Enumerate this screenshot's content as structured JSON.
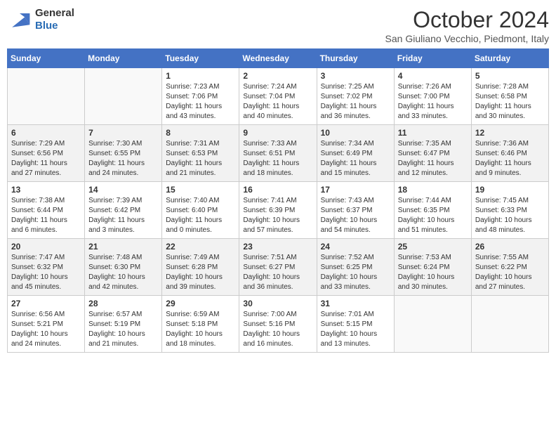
{
  "header": {
    "logo_general": "General",
    "logo_blue": "Blue",
    "month_title": "October 2024",
    "location": "San Giuliano Vecchio, Piedmont, Italy"
  },
  "days_of_week": [
    "Sunday",
    "Monday",
    "Tuesday",
    "Wednesday",
    "Thursday",
    "Friday",
    "Saturday"
  ],
  "weeks": [
    [
      {
        "day": "",
        "sunrise": "",
        "sunset": "",
        "daylight": ""
      },
      {
        "day": "",
        "sunrise": "",
        "sunset": "",
        "daylight": ""
      },
      {
        "day": "1",
        "sunrise": "Sunrise: 7:23 AM",
        "sunset": "Sunset: 7:06 PM",
        "daylight": "Daylight: 11 hours and 43 minutes."
      },
      {
        "day": "2",
        "sunrise": "Sunrise: 7:24 AM",
        "sunset": "Sunset: 7:04 PM",
        "daylight": "Daylight: 11 hours and 40 minutes."
      },
      {
        "day": "3",
        "sunrise": "Sunrise: 7:25 AM",
        "sunset": "Sunset: 7:02 PM",
        "daylight": "Daylight: 11 hours and 36 minutes."
      },
      {
        "day": "4",
        "sunrise": "Sunrise: 7:26 AM",
        "sunset": "Sunset: 7:00 PM",
        "daylight": "Daylight: 11 hours and 33 minutes."
      },
      {
        "day": "5",
        "sunrise": "Sunrise: 7:28 AM",
        "sunset": "Sunset: 6:58 PM",
        "daylight": "Daylight: 11 hours and 30 minutes."
      }
    ],
    [
      {
        "day": "6",
        "sunrise": "Sunrise: 7:29 AM",
        "sunset": "Sunset: 6:56 PM",
        "daylight": "Daylight: 11 hours and 27 minutes."
      },
      {
        "day": "7",
        "sunrise": "Sunrise: 7:30 AM",
        "sunset": "Sunset: 6:55 PM",
        "daylight": "Daylight: 11 hours and 24 minutes."
      },
      {
        "day": "8",
        "sunrise": "Sunrise: 7:31 AM",
        "sunset": "Sunset: 6:53 PM",
        "daylight": "Daylight: 11 hours and 21 minutes."
      },
      {
        "day": "9",
        "sunrise": "Sunrise: 7:33 AM",
        "sunset": "Sunset: 6:51 PM",
        "daylight": "Daylight: 11 hours and 18 minutes."
      },
      {
        "day": "10",
        "sunrise": "Sunrise: 7:34 AM",
        "sunset": "Sunset: 6:49 PM",
        "daylight": "Daylight: 11 hours and 15 minutes."
      },
      {
        "day": "11",
        "sunrise": "Sunrise: 7:35 AM",
        "sunset": "Sunset: 6:47 PM",
        "daylight": "Daylight: 11 hours and 12 minutes."
      },
      {
        "day": "12",
        "sunrise": "Sunrise: 7:36 AM",
        "sunset": "Sunset: 6:46 PM",
        "daylight": "Daylight: 11 hours and 9 minutes."
      }
    ],
    [
      {
        "day": "13",
        "sunrise": "Sunrise: 7:38 AM",
        "sunset": "Sunset: 6:44 PM",
        "daylight": "Daylight: 11 hours and 6 minutes."
      },
      {
        "day": "14",
        "sunrise": "Sunrise: 7:39 AM",
        "sunset": "Sunset: 6:42 PM",
        "daylight": "Daylight: 11 hours and 3 minutes."
      },
      {
        "day": "15",
        "sunrise": "Sunrise: 7:40 AM",
        "sunset": "Sunset: 6:40 PM",
        "daylight": "Daylight: 11 hours and 0 minutes."
      },
      {
        "day": "16",
        "sunrise": "Sunrise: 7:41 AM",
        "sunset": "Sunset: 6:39 PM",
        "daylight": "Daylight: 10 hours and 57 minutes."
      },
      {
        "day": "17",
        "sunrise": "Sunrise: 7:43 AM",
        "sunset": "Sunset: 6:37 PM",
        "daylight": "Daylight: 10 hours and 54 minutes."
      },
      {
        "day": "18",
        "sunrise": "Sunrise: 7:44 AM",
        "sunset": "Sunset: 6:35 PM",
        "daylight": "Daylight: 10 hours and 51 minutes."
      },
      {
        "day": "19",
        "sunrise": "Sunrise: 7:45 AM",
        "sunset": "Sunset: 6:33 PM",
        "daylight": "Daylight: 10 hours and 48 minutes."
      }
    ],
    [
      {
        "day": "20",
        "sunrise": "Sunrise: 7:47 AM",
        "sunset": "Sunset: 6:32 PM",
        "daylight": "Daylight: 10 hours and 45 minutes."
      },
      {
        "day": "21",
        "sunrise": "Sunrise: 7:48 AM",
        "sunset": "Sunset: 6:30 PM",
        "daylight": "Daylight: 10 hours and 42 minutes."
      },
      {
        "day": "22",
        "sunrise": "Sunrise: 7:49 AM",
        "sunset": "Sunset: 6:28 PM",
        "daylight": "Daylight: 10 hours and 39 minutes."
      },
      {
        "day": "23",
        "sunrise": "Sunrise: 7:51 AM",
        "sunset": "Sunset: 6:27 PM",
        "daylight": "Daylight: 10 hours and 36 minutes."
      },
      {
        "day": "24",
        "sunrise": "Sunrise: 7:52 AM",
        "sunset": "Sunset: 6:25 PM",
        "daylight": "Daylight: 10 hours and 33 minutes."
      },
      {
        "day": "25",
        "sunrise": "Sunrise: 7:53 AM",
        "sunset": "Sunset: 6:24 PM",
        "daylight": "Daylight: 10 hours and 30 minutes."
      },
      {
        "day": "26",
        "sunrise": "Sunrise: 7:55 AM",
        "sunset": "Sunset: 6:22 PM",
        "daylight": "Daylight: 10 hours and 27 minutes."
      }
    ],
    [
      {
        "day": "27",
        "sunrise": "Sunrise: 6:56 AM",
        "sunset": "Sunset: 5:21 PM",
        "daylight": "Daylight: 10 hours and 24 minutes."
      },
      {
        "day": "28",
        "sunrise": "Sunrise: 6:57 AM",
        "sunset": "Sunset: 5:19 PM",
        "daylight": "Daylight: 10 hours and 21 minutes."
      },
      {
        "day": "29",
        "sunrise": "Sunrise: 6:59 AM",
        "sunset": "Sunset: 5:18 PM",
        "daylight": "Daylight: 10 hours and 18 minutes."
      },
      {
        "day": "30",
        "sunrise": "Sunrise: 7:00 AM",
        "sunset": "Sunset: 5:16 PM",
        "daylight": "Daylight: 10 hours and 16 minutes."
      },
      {
        "day": "31",
        "sunrise": "Sunrise: 7:01 AM",
        "sunset": "Sunset: 5:15 PM",
        "daylight": "Daylight: 10 hours and 13 minutes."
      },
      {
        "day": "",
        "sunrise": "",
        "sunset": "",
        "daylight": ""
      },
      {
        "day": "",
        "sunrise": "",
        "sunset": "",
        "daylight": ""
      }
    ]
  ]
}
